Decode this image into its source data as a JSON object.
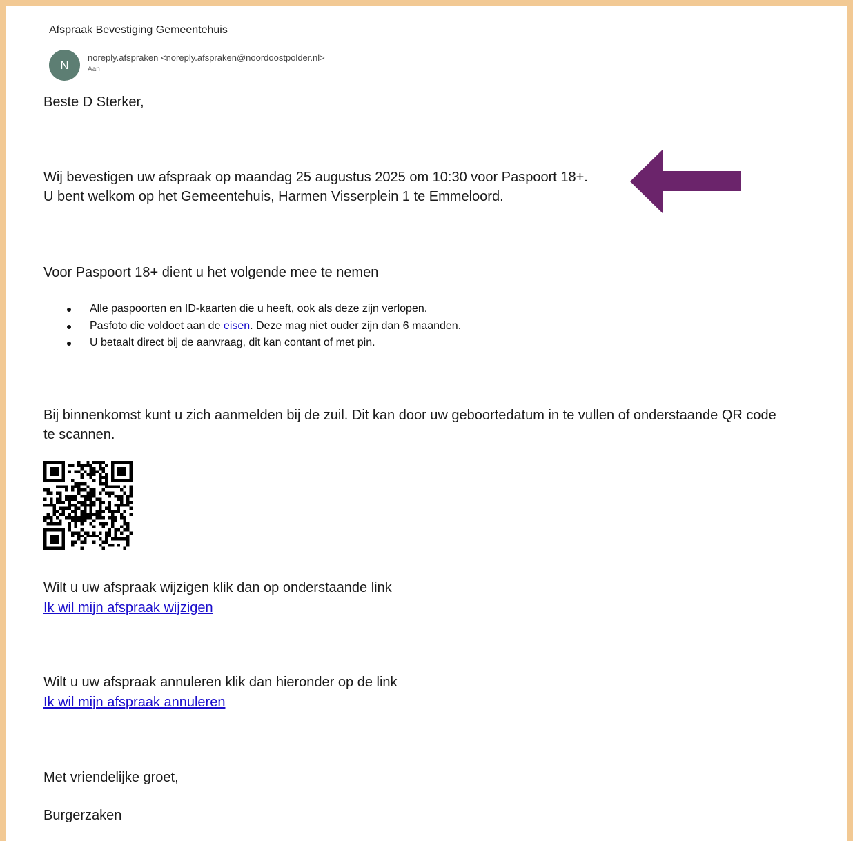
{
  "email": {
    "subject": "Afspraak Bevestiging Gemeentehuis",
    "avatar_initial": "N",
    "sender": "noreply.afspraken <noreply.afspraken@noordoostpolder.nl>",
    "to_label": "Aan"
  },
  "body": {
    "greeting": "Beste D Sterker,",
    "confirm_line1": "Wij bevestigen uw afspraak op maandag 25 augustus 2025 om 10:30 voor Paspoort 18+.",
    "confirm_line2": "U bent welkom op het Gemeentehuis, Harmen Visserplein 1 te Emmeloord.",
    "bring_heading": "Voor Paspoort 18+ dient u het volgende mee te nemen",
    "bullet1": "Alle paspoorten en ID-kaarten die u heeft, ook als deze zijn verlopen.",
    "bullet2_before": "Pasfoto die voldoet aan de ",
    "bullet2_link": "eisen",
    "bullet2_after": ". Deze mag niet ouder zijn dan 6 maanden.",
    "bullet3": "U betaalt direct bij de aanvraag, dit kan contant of met pin.",
    "checkin_line1": "Bij binnenkomst kunt u zich aanmelden bij de zuil. Dit kan door uw geboortedatum in te vullen of onderstaande QR code",
    "checkin_line2": "te scannen.",
    "change_text": "Wilt u uw afspraak wijzigen klik dan op onderstaande link",
    "change_link": "Ik wil mijn afspraak wijzigen",
    "cancel_text": "Wilt u uw afspraak annuleren klik dan hieronder op de link",
    "cancel_link": "Ik wil mijn afspraak annuleren",
    "closing": "Met vriendelijke groet,",
    "signature": "Burgerzaken"
  },
  "colors": {
    "frame": "#f2c994",
    "arrow": "#6b246b",
    "avatar": "#5d7e73",
    "link": "#1a0dcc"
  },
  "icons": {
    "arrow": "left-arrow-icon",
    "qr": "qr-code-icon"
  }
}
